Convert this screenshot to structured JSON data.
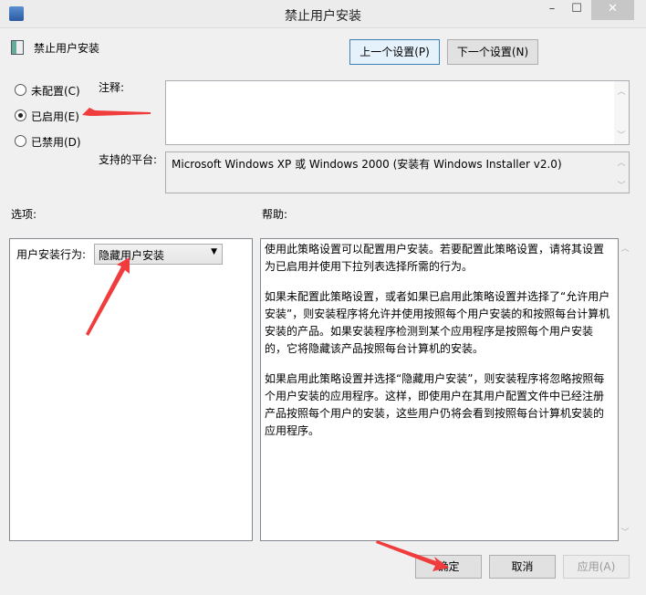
{
  "window": {
    "title": "禁止用户安装",
    "minimize": "–",
    "maximize": "☐",
    "close": "✕"
  },
  "header": {
    "policy_name": "禁止用户安装",
    "prev_label": "上一个设置(P)",
    "next_label": "下一个设置(N)"
  },
  "state": {
    "options": [
      {
        "label": "未配置(C)",
        "selected": false
      },
      {
        "label": "已启用(E)",
        "selected": true
      },
      {
        "label": "已禁用(D)",
        "selected": false
      }
    ]
  },
  "comment": {
    "label": "注释:",
    "value": ""
  },
  "platform": {
    "label": "支持的平台:",
    "value": "Microsoft Windows XP 或 Windows 2000 (安装有 Windows Installer v2.0)"
  },
  "options_section": {
    "label": "选项:",
    "field_label": "用户安装行为:",
    "selected": "隐藏用户安装"
  },
  "help_section": {
    "label": "帮助:",
    "paragraphs": [
      "使用此策略设置可以配置用户安装。若要配置此策略设置，请将其设置为已启用并使用下拉列表选择所需的行为。",
      "如果未配置此策略设置，或者如果已启用此策略设置并选择了“允许用户安装”，则安装程序将允许并使用按照每个用户安装的和按照每台计算机安装的产品。如果安装程序检测到某个应用程序是按照每个用户安装的，它将隐藏该产品按照每台计算机的安装。",
      "如果启用此策略设置并选择“隐藏用户安装”，则安装程序将忽略按照每个用户安装的应用程序。这样，即使用户在其用户配置文件中已经注册产品按照每个用户的安装，这些用户仍将会看到按照每台计算机安装的应用程序。"
    ]
  },
  "footer": {
    "ok": "确定",
    "cancel": "取消",
    "apply": "应用(A)"
  },
  "colors": {
    "annotation_arrow": "#f03c3c",
    "primary_border": "#3c7fb1"
  }
}
